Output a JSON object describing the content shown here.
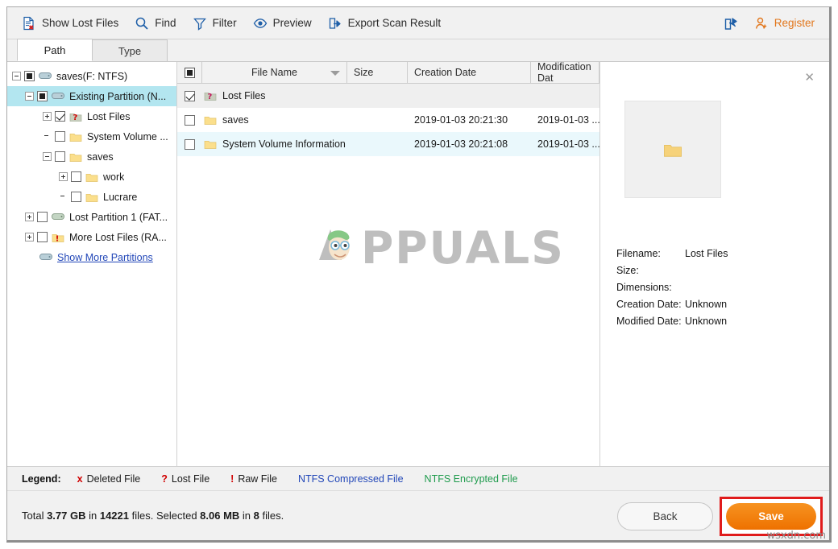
{
  "toolbar": {
    "items": [
      {
        "label": "Show Lost Files",
        "icon": "document-x-icon"
      },
      {
        "label": "Find",
        "icon": "search-icon"
      },
      {
        "label": "Filter",
        "icon": "funnel-icon"
      },
      {
        "label": "Preview",
        "icon": "eye-icon"
      },
      {
        "label": "Export Scan Result",
        "icon": "export-icon"
      }
    ],
    "share_icon": "share-icon",
    "register_label": "Register",
    "register_icon": "user-plus-icon",
    "register_color": "#e2761b"
  },
  "tabs": [
    {
      "label": "Path",
      "active": true
    },
    {
      "label": "Type",
      "active": false
    }
  ],
  "tree": {
    "nodes": [
      {
        "label": "saves(F: NTFS)",
        "indent": 0,
        "expander": "minus",
        "check": "partial",
        "icon": "drive-icon",
        "selected": false
      },
      {
        "label": "Existing Partition (N...",
        "indent": 1,
        "expander": "minus",
        "check": "partial",
        "icon": "drive-icon",
        "selected": true
      },
      {
        "label": "Lost Files",
        "indent": 2,
        "expander": "plus",
        "check": "checked",
        "icon": "folder-lost-icon",
        "selected": false
      },
      {
        "label": "System Volume ...",
        "indent": 2,
        "expander": "none",
        "check": "empty",
        "icon": "folder-icon",
        "selected": false
      },
      {
        "label": "saves",
        "indent": 2,
        "expander": "minus",
        "check": "empty",
        "icon": "folder-icon",
        "selected": false
      },
      {
        "label": "work",
        "indent": 3,
        "expander": "plus",
        "check": "empty",
        "icon": "folder-icon",
        "selected": false
      },
      {
        "label": "Lucrare",
        "indent": 3,
        "expander": "none",
        "check": "empty",
        "icon": "folder-icon",
        "selected": false
      },
      {
        "label": "Lost Partition 1 (FAT...",
        "indent": 1,
        "expander": "plus",
        "check": "empty",
        "icon": "drive-icon",
        "selected": false
      },
      {
        "label": "More Lost Files (RA...",
        "indent": 1,
        "expander": "plus",
        "check": "empty",
        "icon": "folder-raw-icon",
        "selected": false
      }
    ],
    "show_more_label": "Show More Partitions",
    "show_more_icon": "drive-icon",
    "selection_color": "#b3e6f0"
  },
  "filelist": {
    "columns": [
      {
        "key": "checkbox",
        "label": ""
      },
      {
        "key": "name",
        "label": "File Name",
        "sorted": true
      },
      {
        "key": "size",
        "label": "Size"
      },
      {
        "key": "cdate",
        "label": "Creation Date"
      },
      {
        "key": "mdate",
        "label": "Modification Dat"
      }
    ],
    "rows": [
      {
        "name": "Lost Files",
        "size": "",
        "cdate": "",
        "mdate": "",
        "checked": true,
        "icon": "folder-lost-icon",
        "state": "selected"
      },
      {
        "name": "saves",
        "size": "",
        "cdate": "2019-01-03 20:21:30",
        "mdate": "2019-01-03 ...",
        "checked": false,
        "icon": "folder-icon",
        "state": "normal"
      },
      {
        "name": "System Volume Information",
        "size": "",
        "cdate": "2019-01-03 20:21:08",
        "mdate": "2019-01-03 ...",
        "checked": false,
        "icon": "folder-icon",
        "state": "alt"
      }
    ],
    "watermark": "PPUALS"
  },
  "preview": {
    "close_icon": "close-icon",
    "thumb_icon": "folder-icon",
    "fields": [
      {
        "key": "Filename:",
        "value": "Lost Files"
      },
      {
        "key": "Size:",
        "value": ""
      },
      {
        "key": "Dimensions:",
        "value": ""
      },
      {
        "key": "Creation Date:",
        "value": "Unknown"
      },
      {
        "key": "Modified Date:",
        "value": "Unknown"
      }
    ]
  },
  "legend": {
    "title": "Legend:",
    "items": [
      {
        "mark": "x",
        "label": "Deleted File",
        "mark_color": "#d00000",
        "label_color": "#1a1a1a"
      },
      {
        "mark": "?",
        "label": "Lost File",
        "mark_color": "#d00000",
        "label_color": "#1a1a1a"
      },
      {
        "mark": "!",
        "label": "Raw File",
        "mark_color": "#d00000",
        "label_color": "#1a1a1a"
      },
      {
        "mark": "",
        "label": "NTFS Compressed File",
        "mark_color": "",
        "label_color": "#2247b8"
      },
      {
        "mark": "",
        "label": "NTFS Encrypted File",
        "mark_color": "",
        "label_color": "#1f9b4d"
      }
    ]
  },
  "footer": {
    "status_prefix": "Total ",
    "total_size": "3.77 GB",
    "status_mid1": " in ",
    "total_files": "14221",
    "status_mid2": " files.  Selected ",
    "selected_size": "8.06 MB",
    "status_mid3": " in ",
    "selected_files": "8",
    "status_suffix": " files.",
    "back_label": "Back",
    "save_label": "Save",
    "save_color": "#ee7100",
    "highlight_color": "#e01b1b",
    "watermark": "wsxdn.com"
  }
}
